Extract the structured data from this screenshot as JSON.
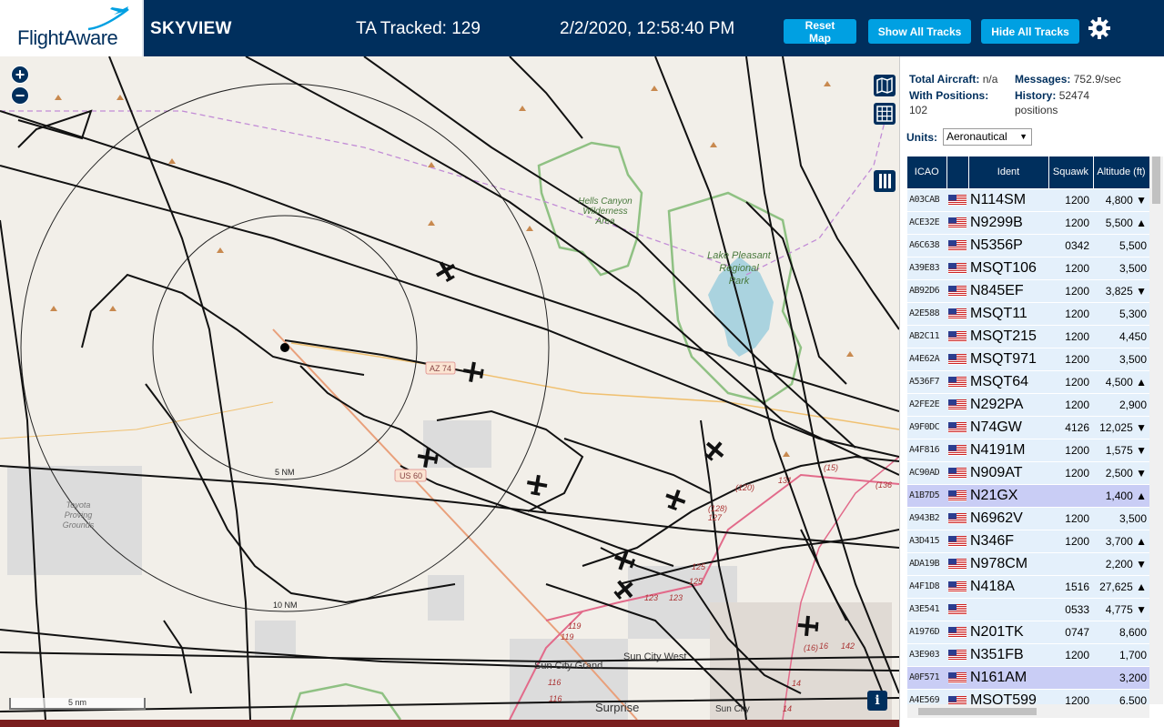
{
  "header": {
    "logo_text": "FlightAware",
    "app_title": "SKYVIEW",
    "tracked": "TA Tracked: 129",
    "clock": "2/2/2020, 12:58:40 PM",
    "buttons": {
      "reset": "Reset Map",
      "show": "Show All Tracks",
      "hide": "Hide All Tracks"
    },
    "settings_icon": "gear-icon",
    "colors": {
      "bar": "#002f5d",
      "button": "#00a0e2"
    }
  },
  "map": {
    "zoom_in": "+",
    "zoom_out": "−",
    "range_rings": [
      "5 NM",
      "10 NM"
    ],
    "scale": "5 nm",
    "info": "i",
    "labels": {
      "hells_canyon": [
        "Hells Canyon",
        "Wilderness",
        "Area"
      ],
      "lake_pleasant": [
        "Lake Pleasant",
        "Regional",
        "Park"
      ],
      "toyota": [
        "Toyota",
        "Proving",
        "Grounds"
      ],
      "sun_city_west": "Sun City West",
      "sun_city_grand": "Sun City Grand",
      "surprise": "Surprise",
      "sun_city": "Sun City",
      "az74": "AZ 74",
      "us60": "US 60",
      "routes": [
        "123",
        "123",
        "125",
        "125",
        "127",
        "(128)",
        "119",
        "119",
        "116",
        "116",
        "131",
        "(120)",
        "(136",
        "(15)",
        "14",
        "14",
        "16",
        "(16)",
        "142"
      ]
    }
  },
  "panel": {
    "total_aircraft_label": "Total Aircraft:",
    "total_aircraft": "n/a",
    "messages_label": "Messages:",
    "messages": "752.9/sec",
    "with_positions_label": "With Positions:",
    "with_positions": "102",
    "history_label": "History:",
    "history": "52474",
    "history_unit": "positions",
    "units_label": "Units:",
    "units_value": "Aeronautical",
    "columns": [
      "ICAO",
      "",
      "Ident",
      "Squawk",
      "Altitude (ft)"
    ],
    "rows": [
      {
        "icao": "A03CAB",
        "ident": "N114SM",
        "squawk": "1200",
        "alt": "4,800 ▼"
      },
      {
        "icao": "ACE32E",
        "ident": "N9299B",
        "squawk": "1200",
        "alt": "5,500 ▲"
      },
      {
        "icao": "A6C638",
        "ident": "N5356P",
        "squawk": "0342",
        "alt": "5,500"
      },
      {
        "icao": "A39E83",
        "ident": "MSQT106",
        "squawk": "1200",
        "alt": "3,500"
      },
      {
        "icao": "AB92D6",
        "ident": "N845EF",
        "squawk": "1200",
        "alt": "3,825 ▼"
      },
      {
        "icao": "A2E588",
        "ident": "MSQT11",
        "squawk": "1200",
        "alt": "5,300"
      },
      {
        "icao": "AB2C11",
        "ident": "MSQT215",
        "squawk": "1200",
        "alt": "4,450"
      },
      {
        "icao": "A4E62A",
        "ident": "MSQT971",
        "squawk": "1200",
        "alt": "3,500"
      },
      {
        "icao": "A536F7",
        "ident": "MSQT64",
        "squawk": "1200",
        "alt": "4,500 ▲"
      },
      {
        "icao": "A2FE2E",
        "ident": "N292PA",
        "squawk": "1200",
        "alt": "2,900"
      },
      {
        "icao": "A9F0DC",
        "ident": "N74GW",
        "squawk": "4126",
        "alt": "12,025 ▼"
      },
      {
        "icao": "A4F816",
        "ident": "N4191M",
        "squawk": "1200",
        "alt": "1,575 ▼"
      },
      {
        "icao": "AC90AD",
        "ident": "N909AT",
        "squawk": "1200",
        "alt": "2,500 ▼"
      },
      {
        "icao": "A1B7D5",
        "ident": "N21GX",
        "squawk": "",
        "alt": "1,400 ▲",
        "selected": true
      },
      {
        "icao": "A943B2",
        "ident": "N6962V",
        "squawk": "1200",
        "alt": "3,500"
      },
      {
        "icao": "A3D415",
        "ident": "N346F",
        "squawk": "1200",
        "alt": "3,700 ▲"
      },
      {
        "icao": "ADA19B",
        "ident": "N978CM",
        "squawk": "",
        "alt": "2,200 ▼"
      },
      {
        "icao": "A4F1D8",
        "ident": "N418A",
        "squawk": "1516",
        "alt": "27,625 ▲"
      },
      {
        "icao": "A3E541",
        "ident": "",
        "squawk": "0533",
        "alt": "4,775 ▼"
      },
      {
        "icao": "A1976D",
        "ident": "N201TK",
        "squawk": "0747",
        "alt": "8,600"
      },
      {
        "icao": "A3E903",
        "ident": "N351FB",
        "squawk": "1200",
        "alt": "1,700"
      },
      {
        "icao": "A0F571",
        "ident": "N161AM",
        "squawk": "",
        "alt": "3,200",
        "selected": true
      },
      {
        "icao": "A4E569",
        "ident": "MSQT599",
        "squawk": "1200",
        "alt": "6,500"
      }
    ]
  }
}
